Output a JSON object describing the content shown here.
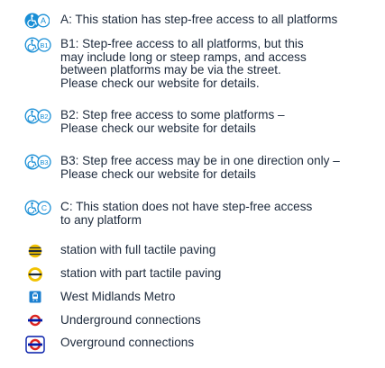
{
  "legend": {
    "items": [
      {
        "icon": "step-free-a-icon",
        "badge": "A",
        "text": "A: This station has step-free access to all platforms"
      },
      {
        "icon": "step-free-b1-icon",
        "badge": "B1",
        "text": "B1: Step-free access to all platforms, but this\nmay include long or steep ramps, and access\nbetween platforms may be via the street.\nPlease check our website for details."
      },
      {
        "icon": "step-free-b2-icon",
        "badge": "B2",
        "text": "B2: Step free access to some platforms –\nPlease check our website for details"
      },
      {
        "icon": "step-free-b3-icon",
        "badge": "B3",
        "text": "B3: Step free access may be in one direction only –\nPlease check our website for details"
      },
      {
        "icon": "step-free-c-icon",
        "badge": "C",
        "text": "C: This station does not have step-free access\nto any platform"
      },
      {
        "icon": "full-tactile-paving-icon",
        "text": "station with full tactile paving"
      },
      {
        "icon": "part-tactile-paving-icon",
        "text": "station with part tactile paving"
      },
      {
        "icon": "west-midlands-metro-icon",
        "text": "West Midlands Metro"
      },
      {
        "icon": "underground-roundel-icon",
        "text": "Underground connections"
      },
      {
        "icon": "overground-roundel-icon",
        "text": "Overground connections"
      }
    ]
  },
  "colors": {
    "text": "#1d2a3c",
    "accessibility_blue": "#1a8fd6",
    "tactile_yellow": "#f2c200",
    "tactile_dark": "#1d2a3c",
    "metro_blue": "#1b7fd0",
    "roundel_red": "#dc241f",
    "roundel_blue": "#0019a8"
  }
}
